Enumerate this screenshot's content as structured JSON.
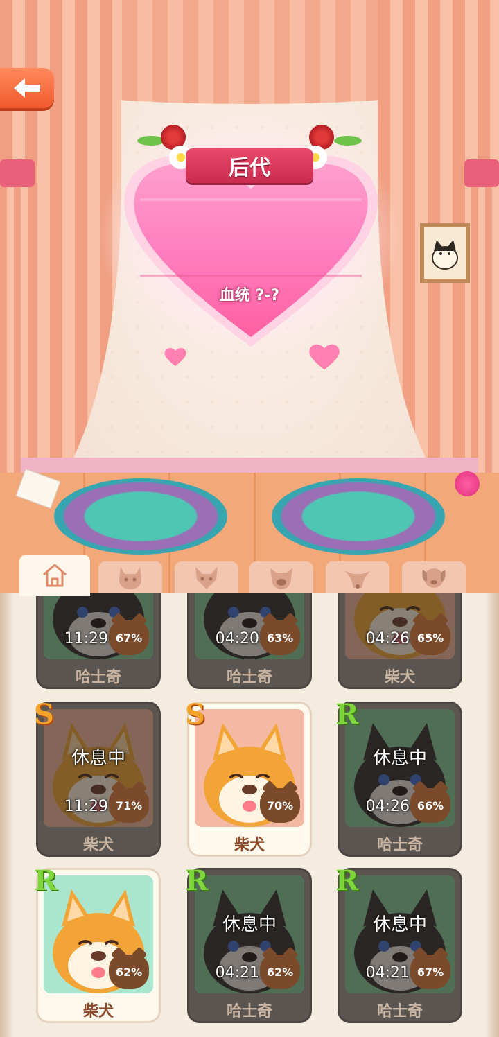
{
  "header": {
    "back_label": "back"
  },
  "offspring": {
    "title": "后代",
    "bloodline": "血统 ?-?"
  },
  "tabs": [
    {
      "icon": "home-icon"
    },
    {
      "icon": "cat-face-icon"
    },
    {
      "icon": "fox-face-icon"
    },
    {
      "icon": "pig-face-icon"
    },
    {
      "icon": "deer-face-icon"
    },
    {
      "icon": "dog-face-icon"
    }
  ],
  "pets": [
    {
      "name": "哈士奇",
      "status": "",
      "timer": "11:29:40",
      "percent": "67%",
      "rarity": "",
      "breed": "husky",
      "resting": true
    },
    {
      "name": "哈士奇",
      "status": "",
      "timer": "04:20:50",
      "percent": "63%",
      "rarity": "",
      "breed": "husky",
      "resting": true
    },
    {
      "name": "柴犬",
      "status": "",
      "timer": "04:26:58",
      "percent": "65%",
      "rarity": "",
      "breed": "shiba",
      "resting": true
    },
    {
      "name": "柴犬",
      "status": "休息中",
      "timer": "11:29:40",
      "percent": "71%",
      "rarity": "S",
      "breed": "shiba",
      "resting": true
    },
    {
      "name": "柴犬",
      "status": "",
      "timer": "",
      "percent": "70%",
      "rarity": "S",
      "breed": "shiba",
      "resting": false
    },
    {
      "name": "哈士奇",
      "status": "休息中",
      "timer": "04:26:58",
      "percent": "66%",
      "rarity": "R",
      "breed": "husky",
      "resting": true
    },
    {
      "name": "柴犬",
      "status": "",
      "timer": "",
      "percent": "62%",
      "rarity": "R",
      "breed": "shiba",
      "resting": false
    },
    {
      "name": "哈士奇",
      "status": "休息中",
      "timer": "04:21:37",
      "percent": "62%",
      "rarity": "R",
      "breed": "husky",
      "resting": true
    },
    {
      "name": "哈士奇",
      "status": "休息中",
      "timer": "04:21:10",
      "percent": "67%",
      "rarity": "R",
      "breed": "husky",
      "resting": true
    }
  ],
  "colors": {
    "accent": "#e94a6b",
    "heart": "#ff8fc4",
    "back_button": "#f26a3a"
  }
}
